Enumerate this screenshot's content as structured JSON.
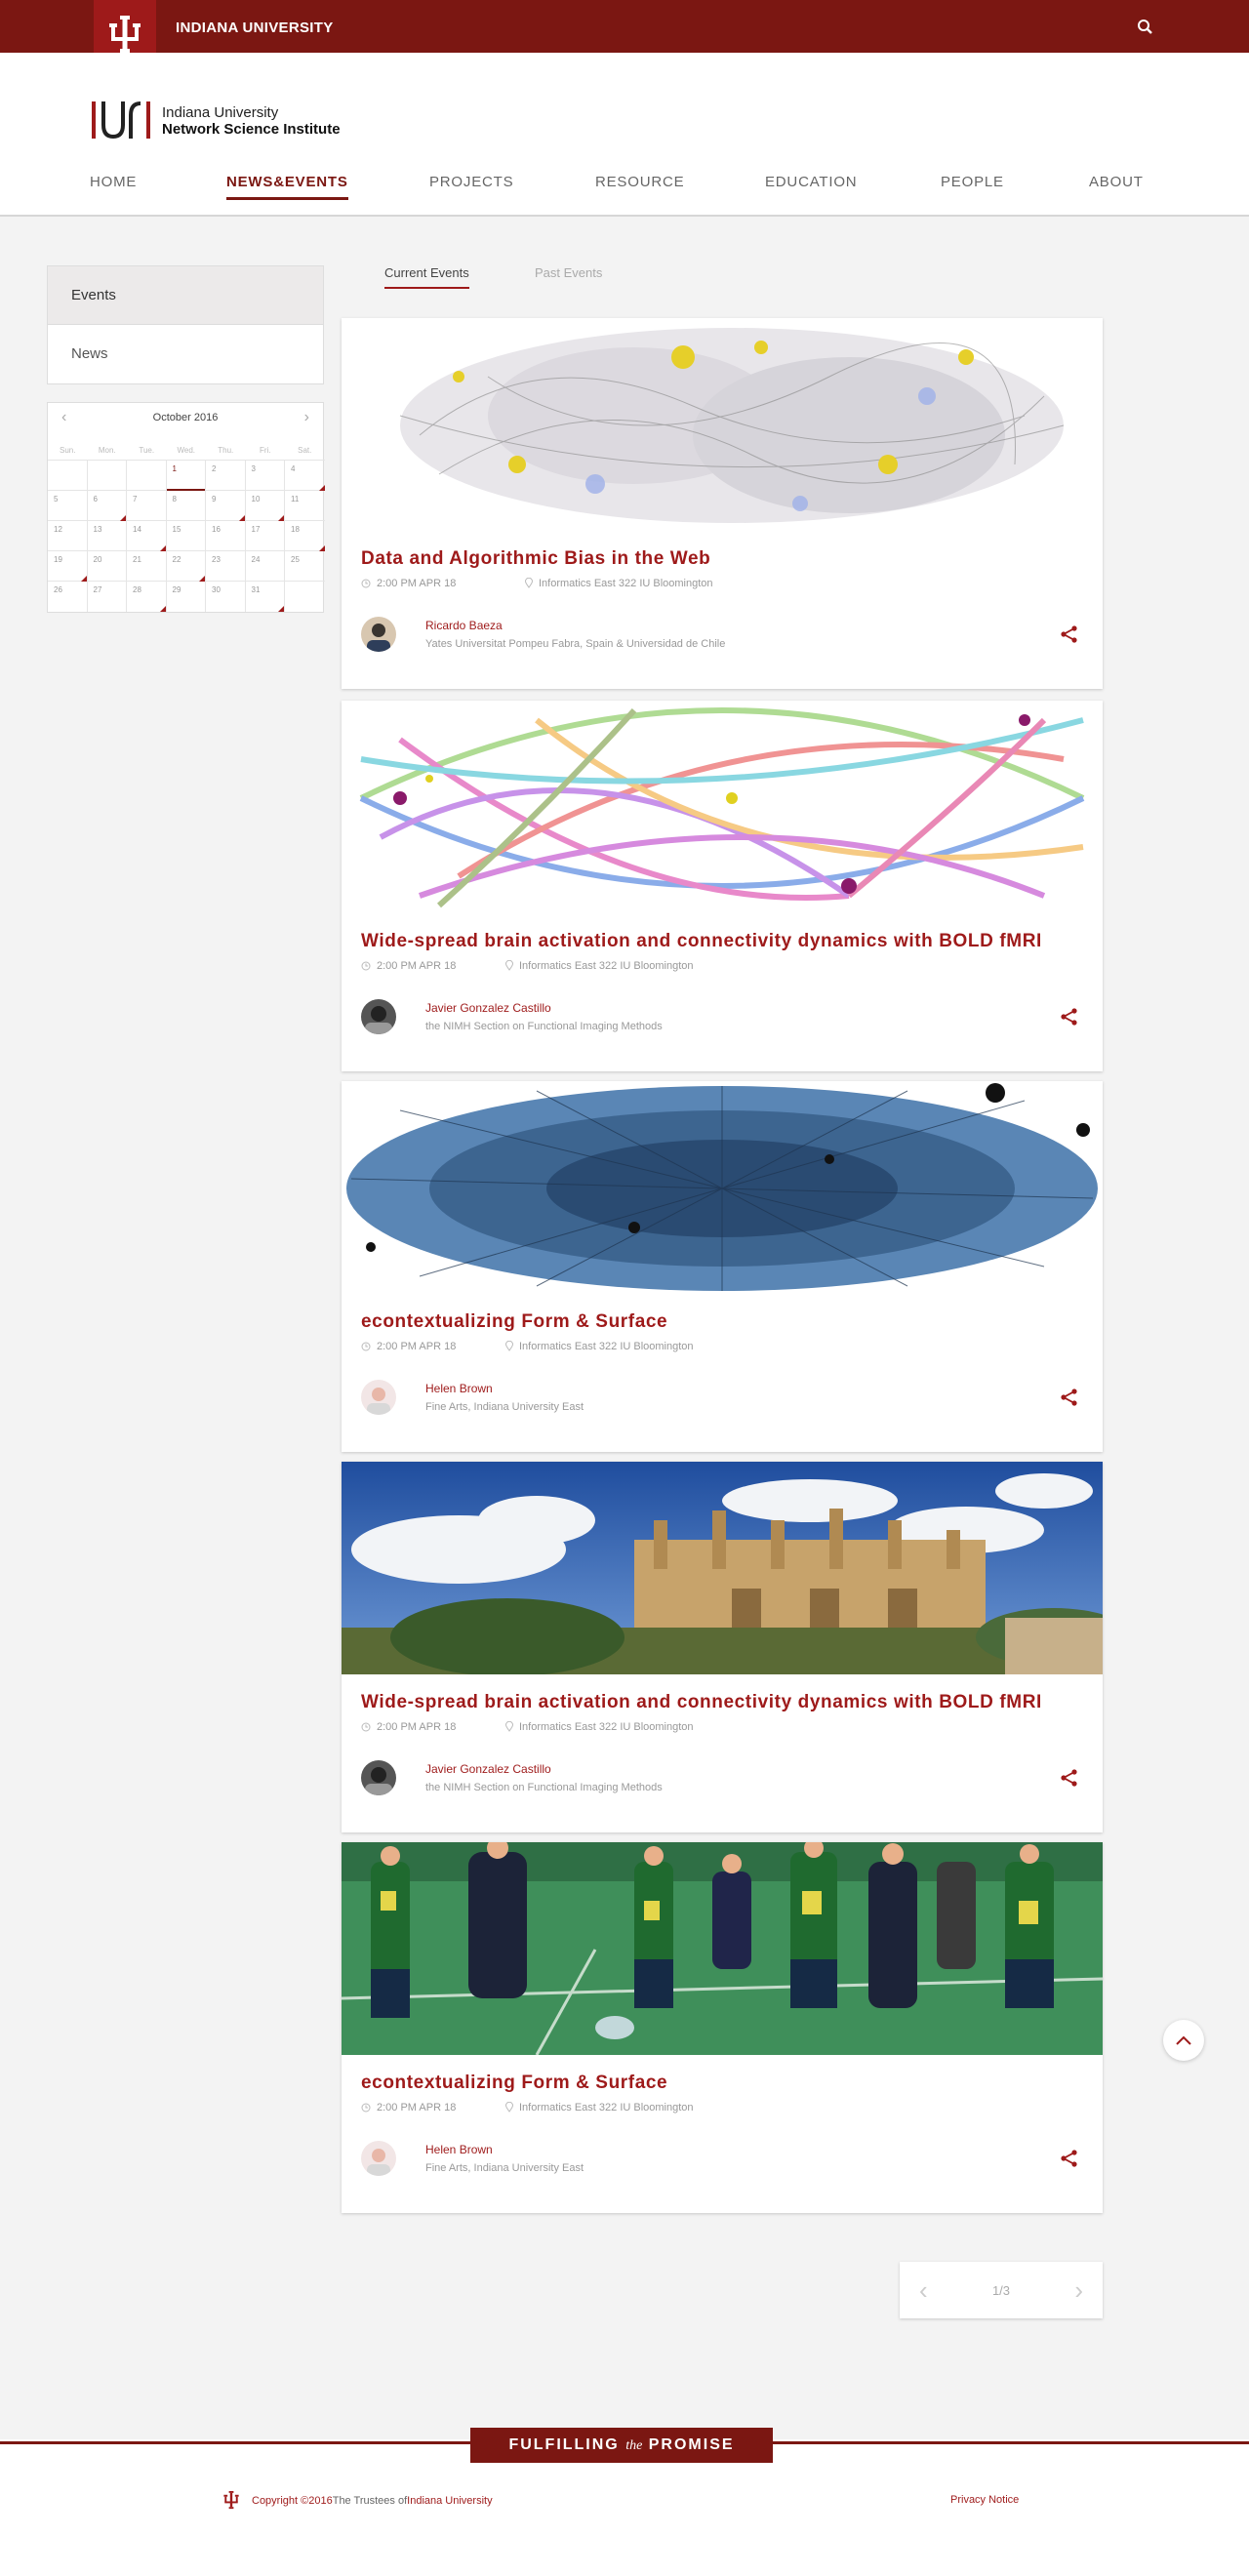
{
  "topbar": {
    "university": "INDIANA UNIVERSITY"
  },
  "brand": {
    "line1": "Indiana University",
    "line2": "Network Science Institute"
  },
  "nav": [
    "HOME",
    "NEWS&EVENTS",
    "PROJECTS",
    "RESOURCE",
    "EDUCATION",
    "PEOPLE",
    "ABOUT"
  ],
  "sidebar": {
    "items": [
      "Events",
      "News"
    ]
  },
  "calendar": {
    "month": "October 2016",
    "dow": [
      "Sun.",
      "Mon.",
      "Tue.",
      "Wed.",
      "Thu.",
      "Fri.",
      "Sat."
    ],
    "weeks": [
      [
        "",
        "",
        "",
        "1",
        "2",
        "3",
        "4"
      ],
      [
        "5",
        "6",
        "7",
        "8",
        "9",
        "10",
        "11"
      ],
      [
        "12",
        "13",
        "14",
        "15",
        "16",
        "17",
        "18"
      ],
      [
        "19",
        "20",
        "21",
        "22",
        "23",
        "24",
        "25"
      ],
      [
        "26",
        "27",
        "28",
        "29",
        "30",
        "31",
        ""
      ]
    ]
  },
  "tabs": {
    "current": "Current Events",
    "past": "Past Events"
  },
  "events": [
    {
      "title": "Data and Algorithmic Bias in the Web",
      "time": "2:00 PM  APR 18",
      "location": "Informatics East 322  IU Bloomington",
      "speaker": "Ricardo Baeza",
      "org": "Yates Universitat Pompeu Fabra, Spain & Universidad de Chile"
    },
    {
      "title": "Wide-spread brain activation and connectivity dynamics with BOLD fMRI",
      "time": "2:00 PM  APR 18",
      "location": "Informatics East 322  IU Bloomington",
      "speaker": "Javier Gonzalez Castillo",
      "org": "the NIMH Section on Functional Imaging Methods"
    },
    {
      "title": "econtextualizing Form & Surface",
      "time": "2:00 PM  APR 18",
      "location": "Informatics East 322  IU Bloomington",
      "speaker": "Helen Brown",
      "org": "Fine Arts, Indiana University East"
    },
    {
      "title": "Wide-spread brain activation and connectivity dynamics with BOLD fMRI",
      "time": "2:00 PM  APR 18",
      "location": "Informatics East 322  IU Bloomington",
      "speaker": "Javier Gonzalez Castillo",
      "org": "the NIMH Section on Functional Imaging Methods"
    },
    {
      "title": "econtextualizing Form & Surface",
      "time": "2:00 PM  APR 18",
      "location": "Informatics East 322  IU Bloomington",
      "speaker": "Helen Brown",
      "org": "Fine Arts, Indiana University East"
    }
  ],
  "pager": {
    "text": "1/3"
  },
  "footer": {
    "promise_a": "FULFILLING ",
    "promise_the": "the",
    "promise_b": " PROMISE",
    "copyright": "Copyright ©2016 ",
    "trustees": "The Trustees of ",
    "iu_link": "Indiana University",
    "privacy": "Privacy Notice"
  },
  "colors": {
    "crimson": "#7b1712",
    "accent": "#9e1a1a",
    "background": "#f3f3f3"
  }
}
